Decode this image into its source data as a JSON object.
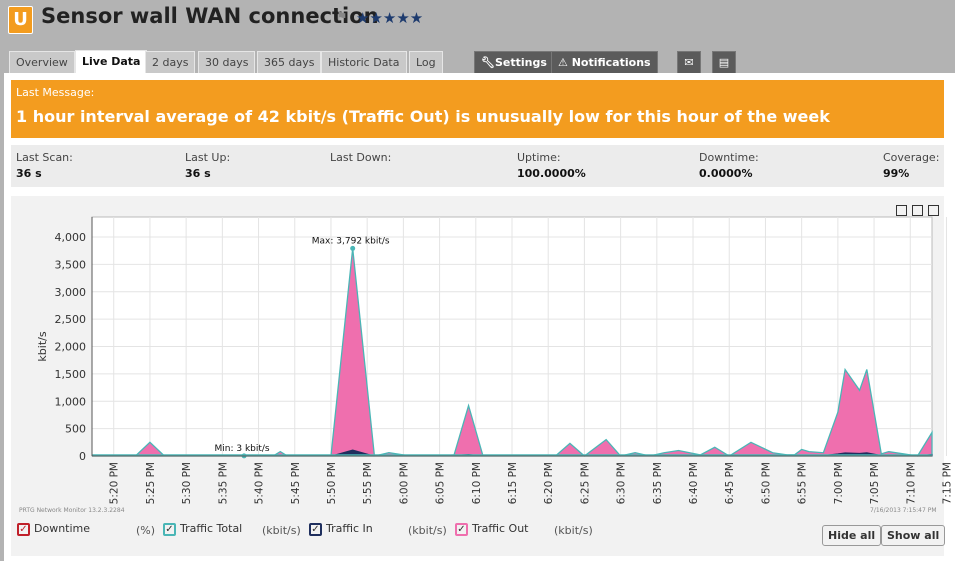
{
  "header": {
    "badge": "U",
    "title": "Sensor wall WAN connection",
    "flag": "⚑",
    "stars": "★★★★★"
  },
  "tabs": [
    {
      "label": "Overview"
    },
    {
      "label": "Live Data"
    },
    {
      "label": "2 days"
    },
    {
      "label": "30 days"
    },
    {
      "label": "365 days"
    },
    {
      "label": "Historic Data"
    },
    {
      "label": "Log"
    }
  ],
  "actions": {
    "settings": "Settings",
    "notifications": "Notifications"
  },
  "message": {
    "label": "Last Message:",
    "text": "1 hour interval average of 42 kbit/s (Traffic Out) is unusually low for this hour of the week"
  },
  "stats": {
    "last_scan": {
      "label": "Last Scan:",
      "value": "36 s"
    },
    "last_up": {
      "label": "Last Up:",
      "value": "36 s"
    },
    "last_down": {
      "label": "Last Down:",
      "value": ""
    },
    "uptime": {
      "label": "Uptime:",
      "value": "100.0000%"
    },
    "downtime": {
      "label": "Downtime:",
      "value": "0.0000%"
    },
    "coverage": {
      "label": "Coverage:",
      "value": "99%"
    }
  },
  "chart_data": {
    "type": "area",
    "ylabel": "kbit/s",
    "ylim": [
      0,
      4000
    ],
    "yticks": [
      "0",
      "500",
      "1,000",
      "1,500",
      "2,000",
      "2,500",
      "3,000",
      "3,500",
      "4,000"
    ],
    "x_tick_labels": [
      "5:20 PM",
      "5:25 PM",
      "5:30 PM",
      "5:35 PM",
      "5:40 PM",
      "5:45 PM",
      "5:50 PM",
      "5:55 PM",
      "6:00 PM",
      "6:05 PM",
      "6:10 PM",
      "6:15 PM",
      "6:20 PM",
      "6:25 PM",
      "6:30 PM",
      "6:35 PM",
      "6:40 PM",
      "6:45 PM",
      "6:50 PM",
      "6:55 PM",
      "7:00 PM",
      "7:05 PM",
      "7:10 PM",
      "7:15 PM"
    ],
    "x_minutes_from": "5:17 PM",
    "x": [
      0,
      3,
      6,
      8,
      10,
      13,
      16,
      19,
      21,
      23,
      25,
      26,
      27,
      28,
      29,
      30,
      33,
      36,
      39,
      41,
      44,
      46,
      48,
      50,
      52,
      54,
      56,
      59,
      61,
      64,
      66,
      68,
      71,
      73,
      75,
      77,
      79,
      81,
      84,
      86,
      88,
      91,
      94,
      96,
      97,
      98,
      99,
      101,
      103,
      104,
      106,
      107,
      109,
      110,
      112,
      114,
      116
    ],
    "series": [
      {
        "name": "Traffic Out",
        "color": "#ef6fae",
        "values": [
          0,
          0,
          0,
          250,
          0,
          0,
          0,
          0,
          0,
          0,
          0,
          80,
          0,
          0,
          10,
          0,
          0,
          3792,
          0,
          60,
          0,
          0,
          0,
          20,
          920,
          0,
          0,
          0,
          10,
          0,
          230,
          0,
          300,
          0,
          60,
          0,
          60,
          100,
          20,
          160,
          0,
          250,
          60,
          20,
          20,
          120,
          80,
          60,
          800,
          1580,
          1200,
          1580,
          40,
          80,
          40,
          0,
          430
        ]
      },
      {
        "name": "Traffic In",
        "color": "#1f2f5e",
        "values": [
          0,
          0,
          0,
          20,
          0,
          0,
          0,
          0,
          0,
          0,
          0,
          10,
          0,
          0,
          0,
          0,
          0,
          110,
          0,
          10,
          0,
          0,
          0,
          10,
          30,
          0,
          0,
          0,
          0,
          0,
          20,
          0,
          20,
          0,
          10,
          0,
          10,
          10,
          0,
          20,
          0,
          20,
          10,
          0,
          0,
          10,
          10,
          10,
          40,
          60,
          50,
          60,
          10,
          20,
          10,
          0,
          30
        ]
      }
    ],
    "annotations": [
      {
        "text": "Max: 3,792 kbit/s",
        "x": 36,
        "y": 3792
      },
      {
        "text": "Min: 3 kbit/s",
        "x": 21,
        "y": 3
      }
    ]
  },
  "chart_footer": {
    "left": "PRTG Network Monitor 13.2.3.2284",
    "right": "7/16/2013 7:15:47 PM"
  },
  "legend": [
    {
      "label": "Downtime",
      "unit": "(%)",
      "color": "#c0202a"
    },
    {
      "label": "Traffic Total",
      "unit": "(kbit/s)",
      "color": "#4ab6b6"
    },
    {
      "label": "Traffic In",
      "unit": "(kbit/s)",
      "color": "#1f2f5e"
    },
    {
      "label": "Traffic Out",
      "unit": "(kbit/s)",
      "color": "#ef6fae"
    }
  ],
  "buttons": {
    "hide_all": "Hide all",
    "show_all": "Show all"
  }
}
